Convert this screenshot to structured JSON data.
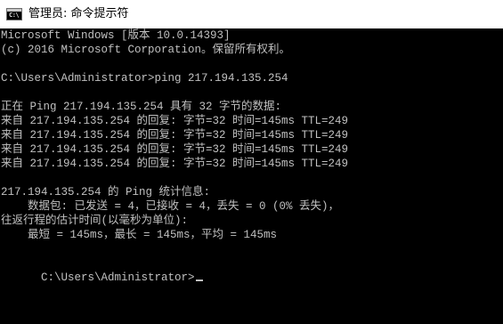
{
  "window": {
    "title": "管理员: 命令提示符",
    "icon": "cmd-icon",
    "icon_text": "C:\\"
  },
  "console": {
    "lines": [
      "Microsoft Windows [版本 10.0.14393]",
      "(c) 2016 Microsoft Corporation。保留所有权利。",
      "",
      "C:\\Users\\Administrator>ping 217.194.135.254",
      "",
      "正在 Ping 217.194.135.254 具有 32 字节的数据:",
      "来自 217.194.135.254 的回复: 字节=32 时间=145ms TTL=249",
      "来自 217.194.135.254 的回复: 字节=32 时间=145ms TTL=249",
      "来自 217.194.135.254 的回复: 字节=32 时间=145ms TTL=249",
      "来自 217.194.135.254 的回复: 字节=32 时间=145ms TTL=249",
      "",
      "217.194.135.254 的 Ping 统计信息:",
      "    数据包: 已发送 = 4，已接收 = 4，丢失 = 0 (0% 丢失)，",
      "往返行程的估计时间(以毫秒为单位):",
      "    最短 = 145ms，最长 = 145ms，平均 = 145ms",
      ""
    ],
    "current_prompt": "C:\\Users\\Administrator>",
    "colors": {
      "background": "#000000",
      "foreground": "#c0c0c0"
    }
  }
}
